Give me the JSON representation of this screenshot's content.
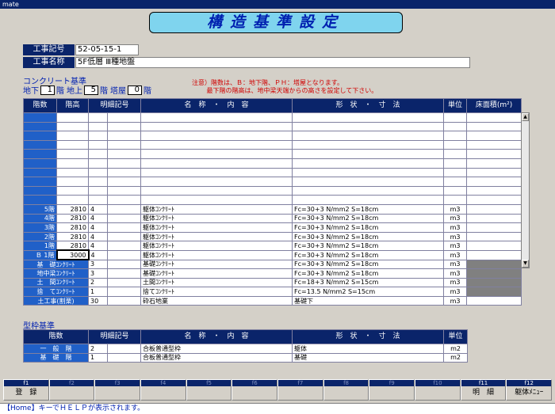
{
  "window": {
    "title": "mate"
  },
  "page_title": "構造基準設定",
  "koji_kigo": {
    "label": "工事記号",
    "value": "52-05-15-1"
  },
  "koji_meisho": {
    "label": "工事名称",
    "value": "5F低層 Ⅲ種地盤"
  },
  "concrete": {
    "section_title": "コンクリート基準",
    "chika_label": "地下",
    "chika_value": "1",
    "chika_unit": "階",
    "chijo_label": "地上",
    "chijo_value": "5",
    "chijo_unit": "階",
    "toya_label": "塔屋",
    "toya_value": "0",
    "toya_unit": "階",
    "note": "注意）階数は、Ｂ：地下階、ＰＨ：塔屋となります。\n　　 最下階の階高は、地中梁天端からの高さを設定して下さい。",
    "headers": [
      "階数",
      "階高",
      "明細記号",
      "名　称　・　内　容",
      "形　状　・　寸　法",
      "単位",
      "床面積(m²)"
    ],
    "empty_rows": 10,
    "rows": [
      {
        "floor": "5階",
        "height": "2810",
        "code": "4",
        "name": "躯体ｺﾝｸﾘｰﾄ",
        "spec": "Fc=30+3 N/mm2 S=18cm",
        "unit": "m3",
        "area": ""
      },
      {
        "floor": "4階",
        "height": "2810",
        "code": "4",
        "name": "躯体ｺﾝｸﾘｰﾄ",
        "spec": "Fc=30+3 N/mm2 S=18cm",
        "unit": "m3",
        "area": ""
      },
      {
        "floor": "3階",
        "height": "2810",
        "code": "4",
        "name": "躯体ｺﾝｸﾘｰﾄ",
        "spec": "Fc=30+3 N/mm2 S=18cm",
        "unit": "m3",
        "area": ""
      },
      {
        "floor": "2階",
        "height": "2810",
        "code": "4",
        "name": "躯体ｺﾝｸﾘｰﾄ",
        "spec": "Fc=30+3 N/mm2 S=18cm",
        "unit": "m3",
        "area": ""
      },
      {
        "floor": "1階",
        "height": "2810",
        "code": "4",
        "name": "躯体ｺﾝｸﾘｰﾄ",
        "spec": "Fc=30+3 N/mm2 S=18cm",
        "unit": "m3",
        "area": ""
      },
      {
        "floor": "Ｂ 1階",
        "height": "3000",
        "code": "4",
        "name": "躯体ｺﾝｸﾘｰﾄ",
        "spec": "Fc=30+3 N/mm2 S=18cm",
        "unit": "m3",
        "area": ""
      }
    ],
    "special_rows": [
      {
        "floor": "基　礎ｺﾝｸﾘｰﾄ",
        "code": "3",
        "name": "基礎ｺﾝｸﾘｰﾄ",
        "spec": "Fc=30+3 N/mm2 S=18cm",
        "unit": "m3"
      },
      {
        "floor": "地中梁ｺﾝｸﾘｰﾄ",
        "code": "3",
        "name": "基礎ｺﾝｸﾘｰﾄ",
        "spec": "Fc=30+3 N/mm2 S=18cm",
        "unit": "m3"
      },
      {
        "floor": "土　間ｺﾝｸﾘｰﾄ",
        "code": "2",
        "name": "土間ｺﾝｸﾘｰﾄ",
        "spec": "Fc=18+3 N/mm2 S=15cm",
        "unit": "m3"
      },
      {
        "floor": "捨　てｺﾝｸﾘｰﾄ",
        "code": "1",
        "name": "捨てｺﾝｸﾘｰﾄ",
        "spec": "Fc=13.5 N/mm2 S=15cm",
        "unit": "m3"
      },
      {
        "floor": "土工事(割栗)",
        "code": "30",
        "name": "砕石地業",
        "spec": "基礎下",
        "unit": "m3"
      }
    ]
  },
  "formwork": {
    "section_title": "型枠基準",
    "headers": [
      "階数",
      "明細記号",
      "名　称　・　内　容",
      "形　状　・　寸　法",
      "単位"
    ],
    "rows": [
      {
        "floor": "一　般　階",
        "code": "2",
        "name": "合板普通型枠",
        "spec": "躯体",
        "unit": "m2"
      },
      {
        "floor": "基　礎　階",
        "code": "1",
        "name": "合板普通型枠",
        "spec": "基礎",
        "unit": "m2"
      }
    ]
  },
  "fkeys": [
    {
      "key": "f1",
      "label": "登　録"
    },
    {
      "key": "f2",
      "label": ""
    },
    {
      "key": "f3",
      "label": ""
    },
    {
      "key": "f4",
      "label": ""
    },
    {
      "key": "f5",
      "label": ""
    },
    {
      "key": "f6",
      "label": ""
    },
    {
      "key": "f7",
      "label": ""
    },
    {
      "key": "f8",
      "label": ""
    },
    {
      "key": "f9",
      "label": ""
    },
    {
      "key": "f10",
      "label": ""
    },
    {
      "key": "f11",
      "label": "明　細"
    },
    {
      "key": "f12",
      "label": "躯体ﾒﾆｭｰ"
    }
  ],
  "status": "【Home】キーでＨＥＬＰが表示されます。",
  "colors": {
    "accent": "#0a246a",
    "row_label": "#2060c8",
    "title_bg": "#7fd4ee",
    "note": "#d00000"
  }
}
